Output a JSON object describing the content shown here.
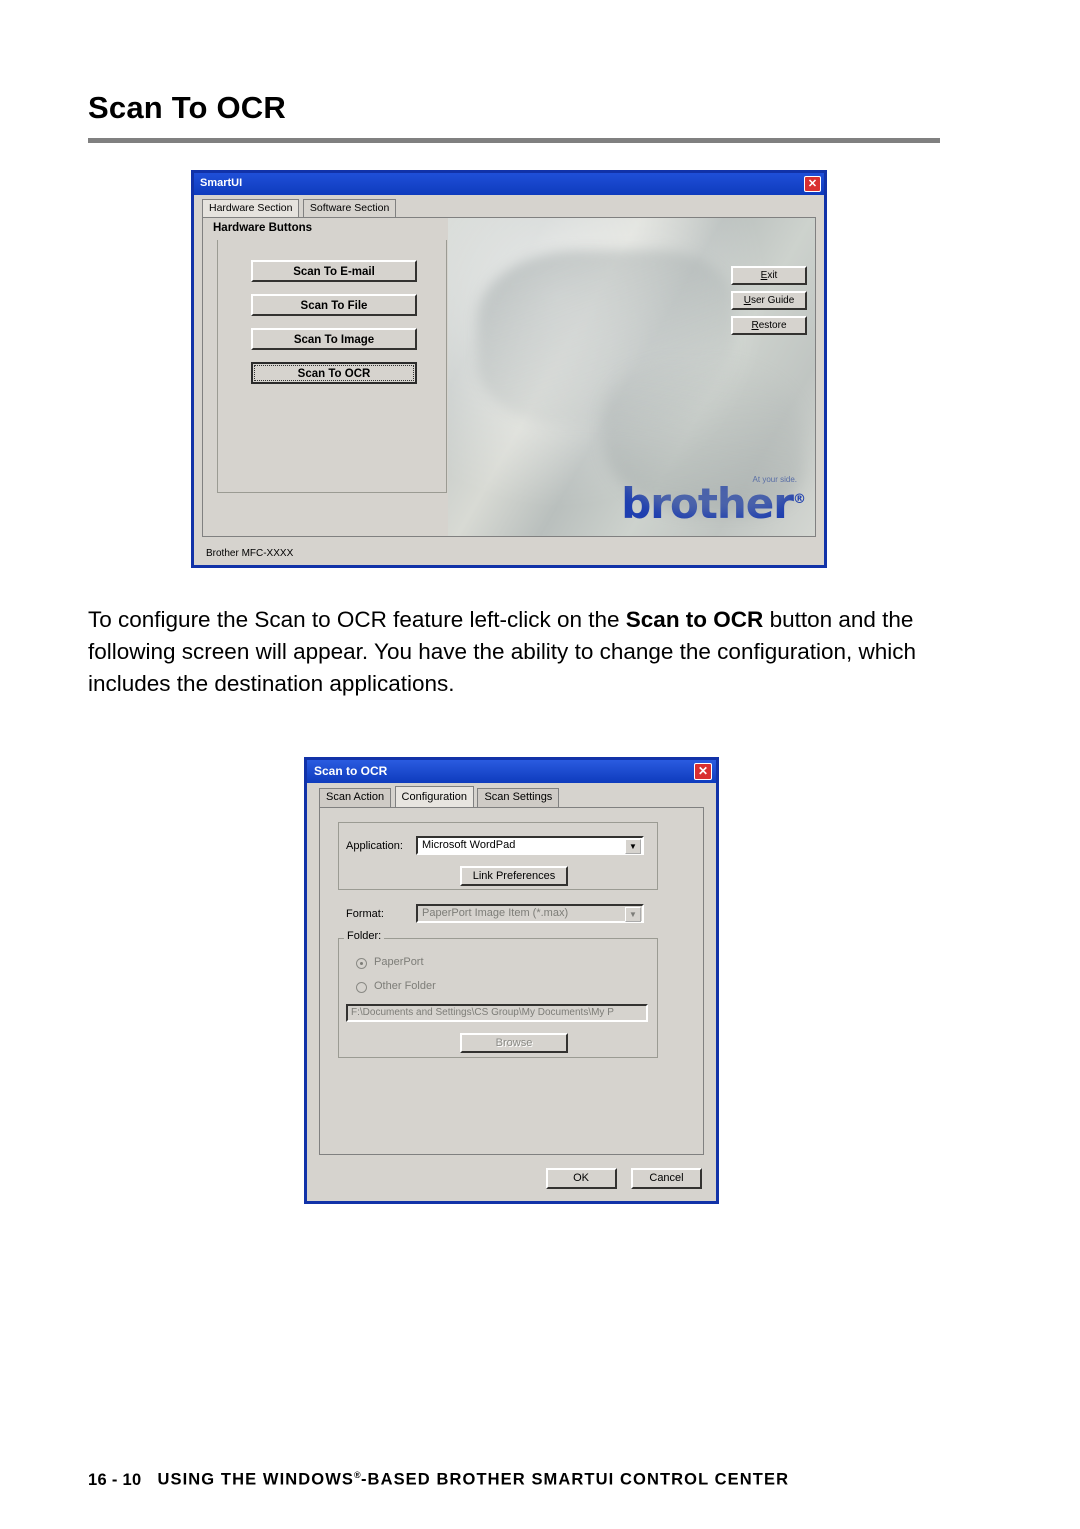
{
  "page": {
    "title": "Scan To OCR",
    "paragraph_prefix": "To configure the Scan to OCR feature left-click on the ",
    "paragraph_bold": "Scan to OCR",
    "paragraph_suffix": " button and the following screen will appear. You have the ability to change the configuration, which includes the destination applications.",
    "footer_page": "16 - 10",
    "footer_text_a": "USING THE WINDOWS",
    "footer_reg": "®",
    "footer_text_b": "-BASED BROTHER SMARTUI CONTROL CENTER"
  },
  "smartui": {
    "window_title": "SmartUI",
    "close_glyph": "✕",
    "tabs": [
      {
        "label": "Hardware Section",
        "active": true
      },
      {
        "label": "Software Section",
        "active": false
      }
    ],
    "group_label": "Hardware Buttons",
    "buttons": [
      "Scan To E-mail",
      "Scan To File",
      "Scan To Image",
      "Scan To OCR"
    ],
    "side_buttons": [
      {
        "pre": "E",
        "rest": "xit"
      },
      {
        "pre": "U",
        "rest": "ser Guide"
      },
      {
        "pre": "R",
        "rest": "estore"
      }
    ],
    "logo_text": "brother",
    "logo_reg": "®",
    "tagline": "At your side.",
    "status": "Brother MFC-XXXX"
  },
  "ocr_dialog": {
    "window_title": "Scan to OCR",
    "close_glyph": "✕",
    "tabs": [
      {
        "label": "Scan Action",
        "active": false
      },
      {
        "label": "Configuration",
        "active": true
      },
      {
        "label": "Scan Settings",
        "active": false
      }
    ],
    "application_label": "Application:",
    "application_value": "Microsoft WordPad",
    "link_preferences_label": "Link Preferences",
    "format_label": "Format:",
    "format_value": "PaperPort Image Item (*.max)",
    "folder_group_label": "Folder:",
    "radio_paperport": "PaperPort",
    "radio_other_folder": "Other Folder",
    "folder_path": "F:\\Documents and Settings\\CS Group\\My Documents\\My P",
    "browse_label": "Browse",
    "ok_label": "OK",
    "cancel_label": "Cancel",
    "dropdown_arrow": "▼"
  },
  "colors": {
    "title_rule": "#808080",
    "window_border": "#1132a8",
    "titlebar": "#0e3bbd",
    "close_button": "#d93030",
    "dialog_face": "#d6d3ce",
    "brother_blue": "#1e3fb0"
  }
}
